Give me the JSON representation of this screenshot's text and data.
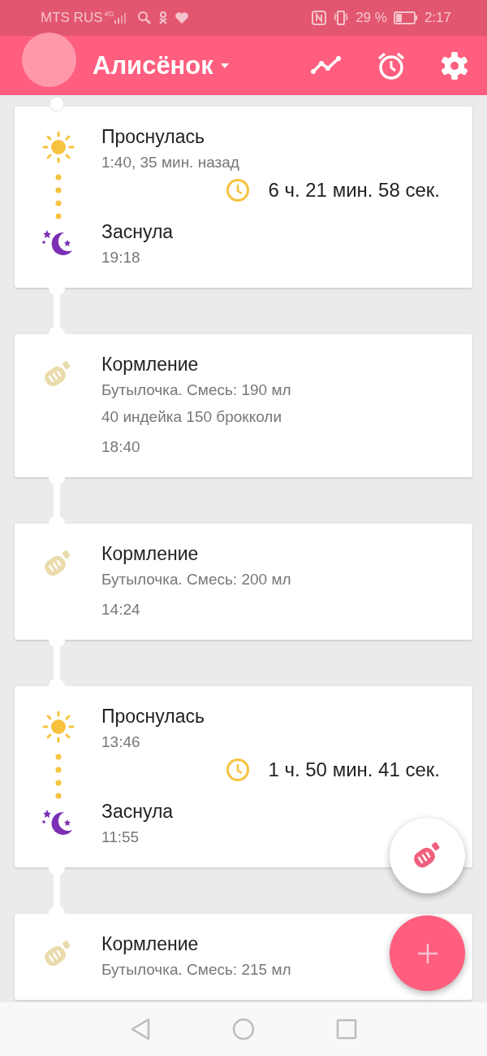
{
  "status_bar": {
    "carrier": "MTS RUS",
    "network": "4G",
    "battery": "29 %",
    "time": "2:17"
  },
  "app_bar": {
    "child_name": "Алисёнок"
  },
  "events": [
    {
      "kind": "sleep",
      "wake_title": "Проснулась",
      "wake_time": "1:40, 35 мин. назад",
      "duration": "6 ч. 21 мин. 58 сек.",
      "sleep_title": "Заснула",
      "sleep_time": "19:18"
    },
    {
      "kind": "feeding",
      "title": "Кормление",
      "details": [
        "Бутылочка. Смесь: 190 мл",
        "40 индейка 150 брокколи"
      ],
      "time": "18:40"
    },
    {
      "kind": "feeding",
      "title": "Кормление",
      "details": [
        "Бутылочка. Смесь: 200 мл"
      ],
      "time": "14:24"
    },
    {
      "kind": "sleep",
      "wake_title": "Проснулась",
      "wake_time": "13:46",
      "duration": "1 ч. 50 мин. 41 сек.",
      "sleep_title": "Заснула",
      "sleep_time": "11:55"
    },
    {
      "kind": "feeding",
      "title": "Кормление",
      "details": [
        "Бутылочка. Смесь: 215 мл"
      ]
    }
  ]
}
